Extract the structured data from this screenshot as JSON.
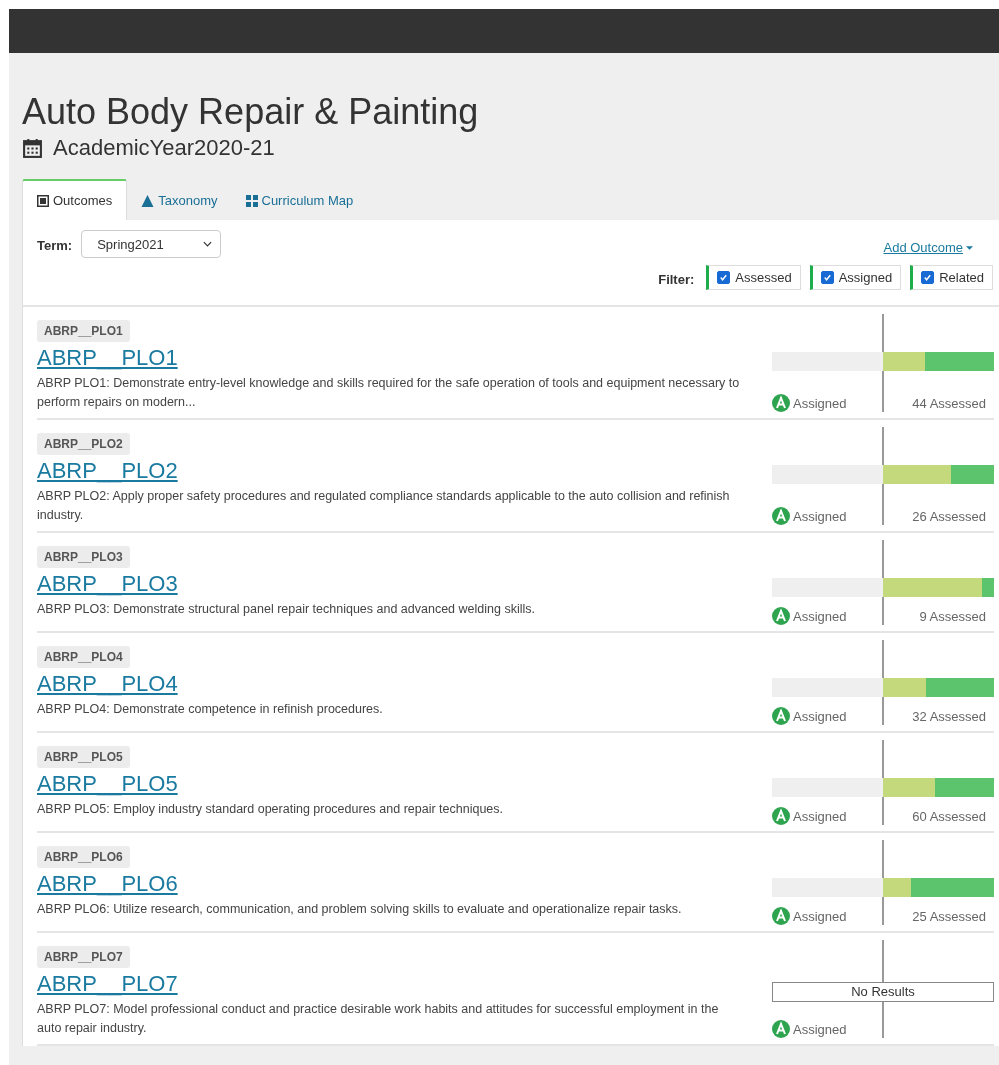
{
  "header": {
    "title": "Auto Body Repair & Painting",
    "subtitle": "AcademicYear2020-21"
  },
  "tabs": [
    {
      "label": "Outcomes",
      "selected": true
    },
    {
      "label": "Taxonomy",
      "selected": false
    },
    {
      "label": "Curriculum Map",
      "selected": false
    }
  ],
  "term": {
    "label": "Term:",
    "value": "Spring2021"
  },
  "add_outcome": "Add Outcome",
  "filter": {
    "label": "Filter:",
    "options": [
      {
        "label": "Assessed",
        "checked": true
      },
      {
        "label": "Assigned",
        "checked": true
      },
      {
        "label": "Related",
        "checked": true
      }
    ]
  },
  "outcomes": [
    {
      "tag": "ABRP__PLO1",
      "title": "ABRP__PLO1",
      "description": "ABRP PLO1: Demonstrate entry-level knowledge and skills required for the safe operation of tools and equipment necessary to perform repairs on modern...",
      "status": "Assigned",
      "kind": "result",
      "level": 0.62,
      "assessed": "44 Assessed"
    },
    {
      "tag": "ABRP__PLO2",
      "title": "ABRP__PLO2",
      "description": "ABRP PLO2: Apply proper safety procedures and regulated compliance standards applicable to the auto collision and refinish industry.",
      "status": "Assigned",
      "kind": "result",
      "level": 0.39,
      "assessed": "26 Assessed"
    },
    {
      "tag": "ABRP__PLO3",
      "title": "ABRP__PLO3",
      "description": "ABRP PLO3: Demonstrate structural panel repair techniques and advanced welding skills.",
      "status": "Assigned",
      "kind": "result",
      "level": 0.11,
      "assessed": "9 Assessed"
    },
    {
      "tag": "ABRP__PLO4",
      "title": "ABRP__PLO4",
      "description": "ABRP PLO4: Demonstrate competence in refinish procedures.",
      "status": "Assigned",
      "kind": "result",
      "level": 0.61,
      "assessed": "32 Assessed"
    },
    {
      "tag": "ABRP__PLO5",
      "title": "ABRP__PLO5",
      "description": "ABRP PLO5: Employ industry standard operating procedures and repair techniques.",
      "status": "Assigned",
      "kind": "result",
      "level": 0.53,
      "assessed": "60 Assessed"
    },
    {
      "tag": "ABRP__PLO6",
      "title": "ABRP__PLO6",
      "description": "ABRP PLO6: Utilize research, communication, and problem solving skills to evaluate and operationalize repair tasks.",
      "status": "Assigned",
      "kind": "result",
      "level": 0.75,
      "assessed": "25 Assessed"
    },
    {
      "tag": "ABRP__PLO7",
      "title": "ABRP__PLO7",
      "description": "ABRP PLO7: Model professional conduct and practice desirable work habits and attitudes for successful employment in the auto repair industry.",
      "status": "Assigned",
      "kind": "empty",
      "message": "No Results"
    }
  ]
}
